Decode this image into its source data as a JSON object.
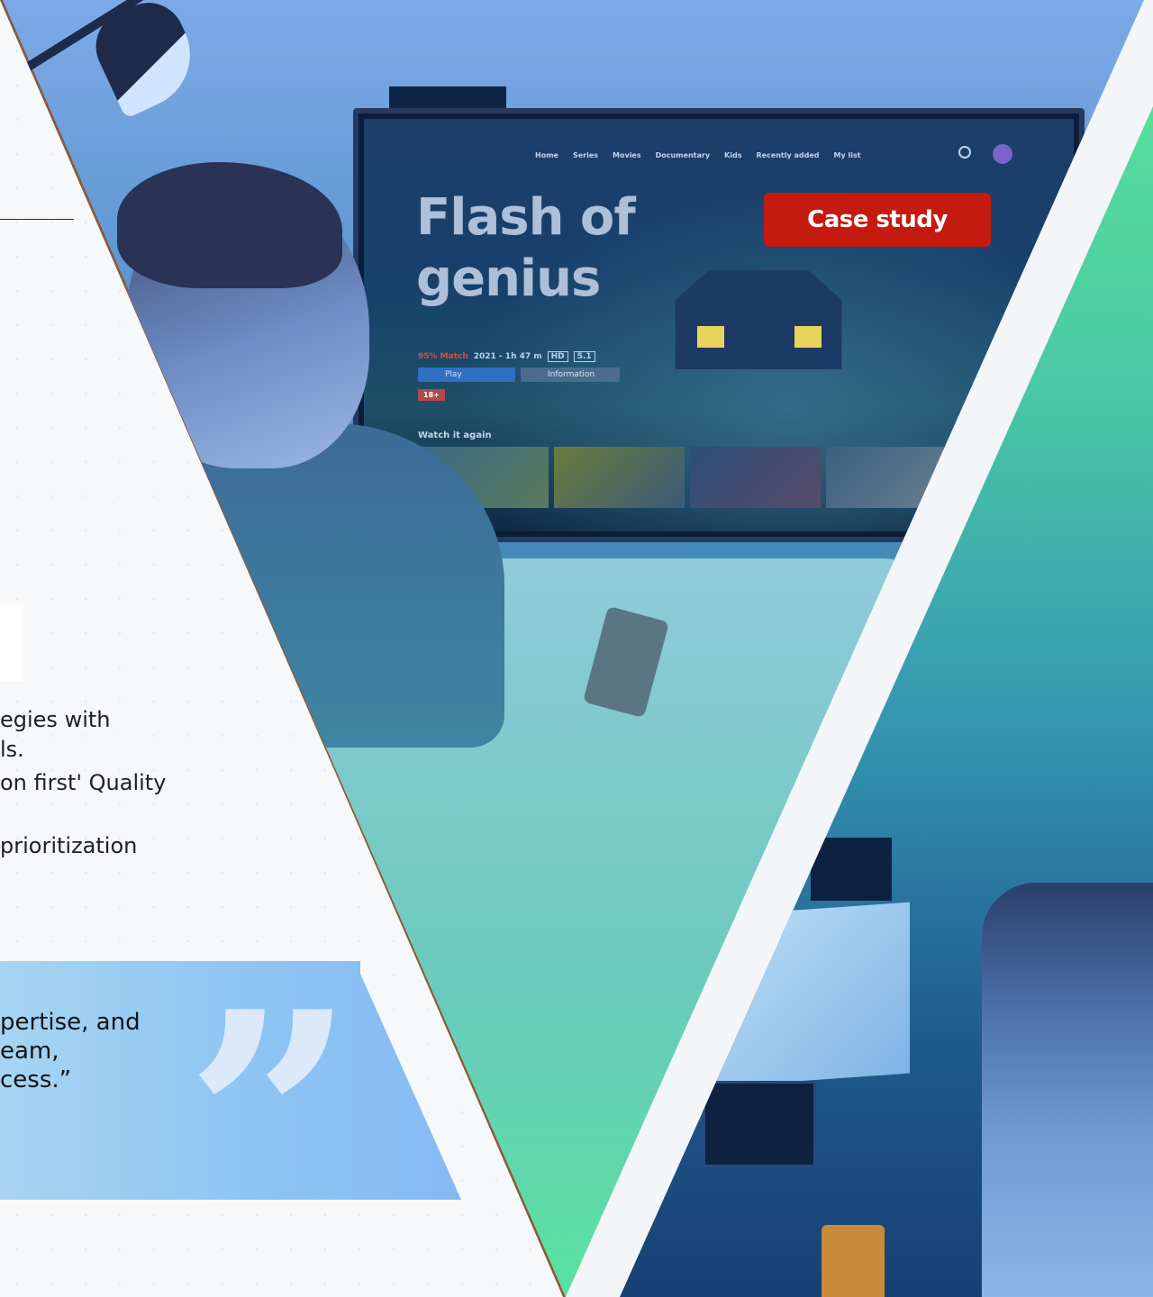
{
  "hero": {
    "badge_label": "Case study"
  },
  "tv": {
    "nav_items": [
      "Home",
      "Series",
      "Movies",
      "Documentary",
      "Kids",
      "Recently added",
      "My list"
    ],
    "title": "Flash of genius",
    "match": "95% Match",
    "year_runtime": "2021 - 1h 47 m",
    "quality": "HD",
    "audio": "5.1",
    "play_label": "Play",
    "info_label": "Information",
    "age_rating": "18+",
    "row_title": "Watch it again"
  },
  "content": {
    "bullets": [
      "egies with",
      "ls.",
      "on first' Quality",
      " prioritization"
    ]
  },
  "testimonial": {
    "lines": [
      "pertise, and",
      "eam,",
      "cess.”"
    ],
    "quote_glyph": "”"
  },
  "colors": {
    "badge_bg": "#c41a10",
    "quote_band": "#8fc6f2",
    "green_accent": "#5ee59a"
  }
}
